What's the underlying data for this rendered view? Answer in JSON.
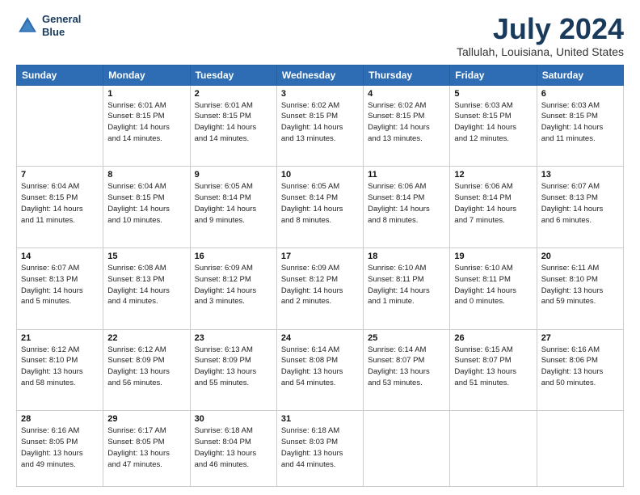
{
  "header": {
    "logo_line1": "General",
    "logo_line2": "Blue",
    "title": "July 2024",
    "subtitle": "Tallulah, Louisiana, United States"
  },
  "days_of_week": [
    "Sunday",
    "Monday",
    "Tuesday",
    "Wednesday",
    "Thursday",
    "Friday",
    "Saturday"
  ],
  "weeks": [
    [
      {
        "day": "",
        "sunrise": "",
        "sunset": "",
        "daylight": ""
      },
      {
        "day": "1",
        "sunrise": "6:01 AM",
        "sunset": "8:15 PM",
        "daylight": "14 hours and 14 minutes."
      },
      {
        "day": "2",
        "sunrise": "6:01 AM",
        "sunset": "8:15 PM",
        "daylight": "14 hours and 14 minutes."
      },
      {
        "day": "3",
        "sunrise": "6:02 AM",
        "sunset": "8:15 PM",
        "daylight": "14 hours and 13 minutes."
      },
      {
        "day": "4",
        "sunrise": "6:02 AM",
        "sunset": "8:15 PM",
        "daylight": "14 hours and 13 minutes."
      },
      {
        "day": "5",
        "sunrise": "6:03 AM",
        "sunset": "8:15 PM",
        "daylight": "14 hours and 12 minutes."
      },
      {
        "day": "6",
        "sunrise": "6:03 AM",
        "sunset": "8:15 PM",
        "daylight": "14 hours and 11 minutes."
      }
    ],
    [
      {
        "day": "7",
        "sunrise": "6:04 AM",
        "sunset": "8:15 PM",
        "daylight": "14 hours and 11 minutes."
      },
      {
        "day": "8",
        "sunrise": "6:04 AM",
        "sunset": "8:15 PM",
        "daylight": "14 hours and 10 minutes."
      },
      {
        "day": "9",
        "sunrise": "6:05 AM",
        "sunset": "8:14 PM",
        "daylight": "14 hours and 9 minutes."
      },
      {
        "day": "10",
        "sunrise": "6:05 AM",
        "sunset": "8:14 PM",
        "daylight": "14 hours and 8 minutes."
      },
      {
        "day": "11",
        "sunrise": "6:06 AM",
        "sunset": "8:14 PM",
        "daylight": "14 hours and 8 minutes."
      },
      {
        "day": "12",
        "sunrise": "6:06 AM",
        "sunset": "8:14 PM",
        "daylight": "14 hours and 7 minutes."
      },
      {
        "day": "13",
        "sunrise": "6:07 AM",
        "sunset": "8:13 PM",
        "daylight": "14 hours and 6 minutes."
      }
    ],
    [
      {
        "day": "14",
        "sunrise": "6:07 AM",
        "sunset": "8:13 PM",
        "daylight": "14 hours and 5 minutes."
      },
      {
        "day": "15",
        "sunrise": "6:08 AM",
        "sunset": "8:13 PM",
        "daylight": "14 hours and 4 minutes."
      },
      {
        "day": "16",
        "sunrise": "6:09 AM",
        "sunset": "8:12 PM",
        "daylight": "14 hours and 3 minutes."
      },
      {
        "day": "17",
        "sunrise": "6:09 AM",
        "sunset": "8:12 PM",
        "daylight": "14 hours and 2 minutes."
      },
      {
        "day": "18",
        "sunrise": "6:10 AM",
        "sunset": "8:11 PM",
        "daylight": "14 hours and 1 minute."
      },
      {
        "day": "19",
        "sunrise": "6:10 AM",
        "sunset": "8:11 PM",
        "daylight": "14 hours and 0 minutes."
      },
      {
        "day": "20",
        "sunrise": "6:11 AM",
        "sunset": "8:10 PM",
        "daylight": "13 hours and 59 minutes."
      }
    ],
    [
      {
        "day": "21",
        "sunrise": "6:12 AM",
        "sunset": "8:10 PM",
        "daylight": "13 hours and 58 minutes."
      },
      {
        "day": "22",
        "sunrise": "6:12 AM",
        "sunset": "8:09 PM",
        "daylight": "13 hours and 56 minutes."
      },
      {
        "day": "23",
        "sunrise": "6:13 AM",
        "sunset": "8:09 PM",
        "daylight": "13 hours and 55 minutes."
      },
      {
        "day": "24",
        "sunrise": "6:14 AM",
        "sunset": "8:08 PM",
        "daylight": "13 hours and 54 minutes."
      },
      {
        "day": "25",
        "sunrise": "6:14 AM",
        "sunset": "8:07 PM",
        "daylight": "13 hours and 53 minutes."
      },
      {
        "day": "26",
        "sunrise": "6:15 AM",
        "sunset": "8:07 PM",
        "daylight": "13 hours and 51 minutes."
      },
      {
        "day": "27",
        "sunrise": "6:16 AM",
        "sunset": "8:06 PM",
        "daylight": "13 hours and 50 minutes."
      }
    ],
    [
      {
        "day": "28",
        "sunrise": "6:16 AM",
        "sunset": "8:05 PM",
        "daylight": "13 hours and 49 minutes."
      },
      {
        "day": "29",
        "sunrise": "6:17 AM",
        "sunset": "8:05 PM",
        "daylight": "13 hours and 47 minutes."
      },
      {
        "day": "30",
        "sunrise": "6:18 AM",
        "sunset": "8:04 PM",
        "daylight": "13 hours and 46 minutes."
      },
      {
        "day": "31",
        "sunrise": "6:18 AM",
        "sunset": "8:03 PM",
        "daylight": "13 hours and 44 minutes."
      },
      {
        "day": "",
        "sunrise": "",
        "sunset": "",
        "daylight": ""
      },
      {
        "day": "",
        "sunrise": "",
        "sunset": "",
        "daylight": ""
      },
      {
        "day": "",
        "sunrise": "",
        "sunset": "",
        "daylight": ""
      }
    ]
  ]
}
